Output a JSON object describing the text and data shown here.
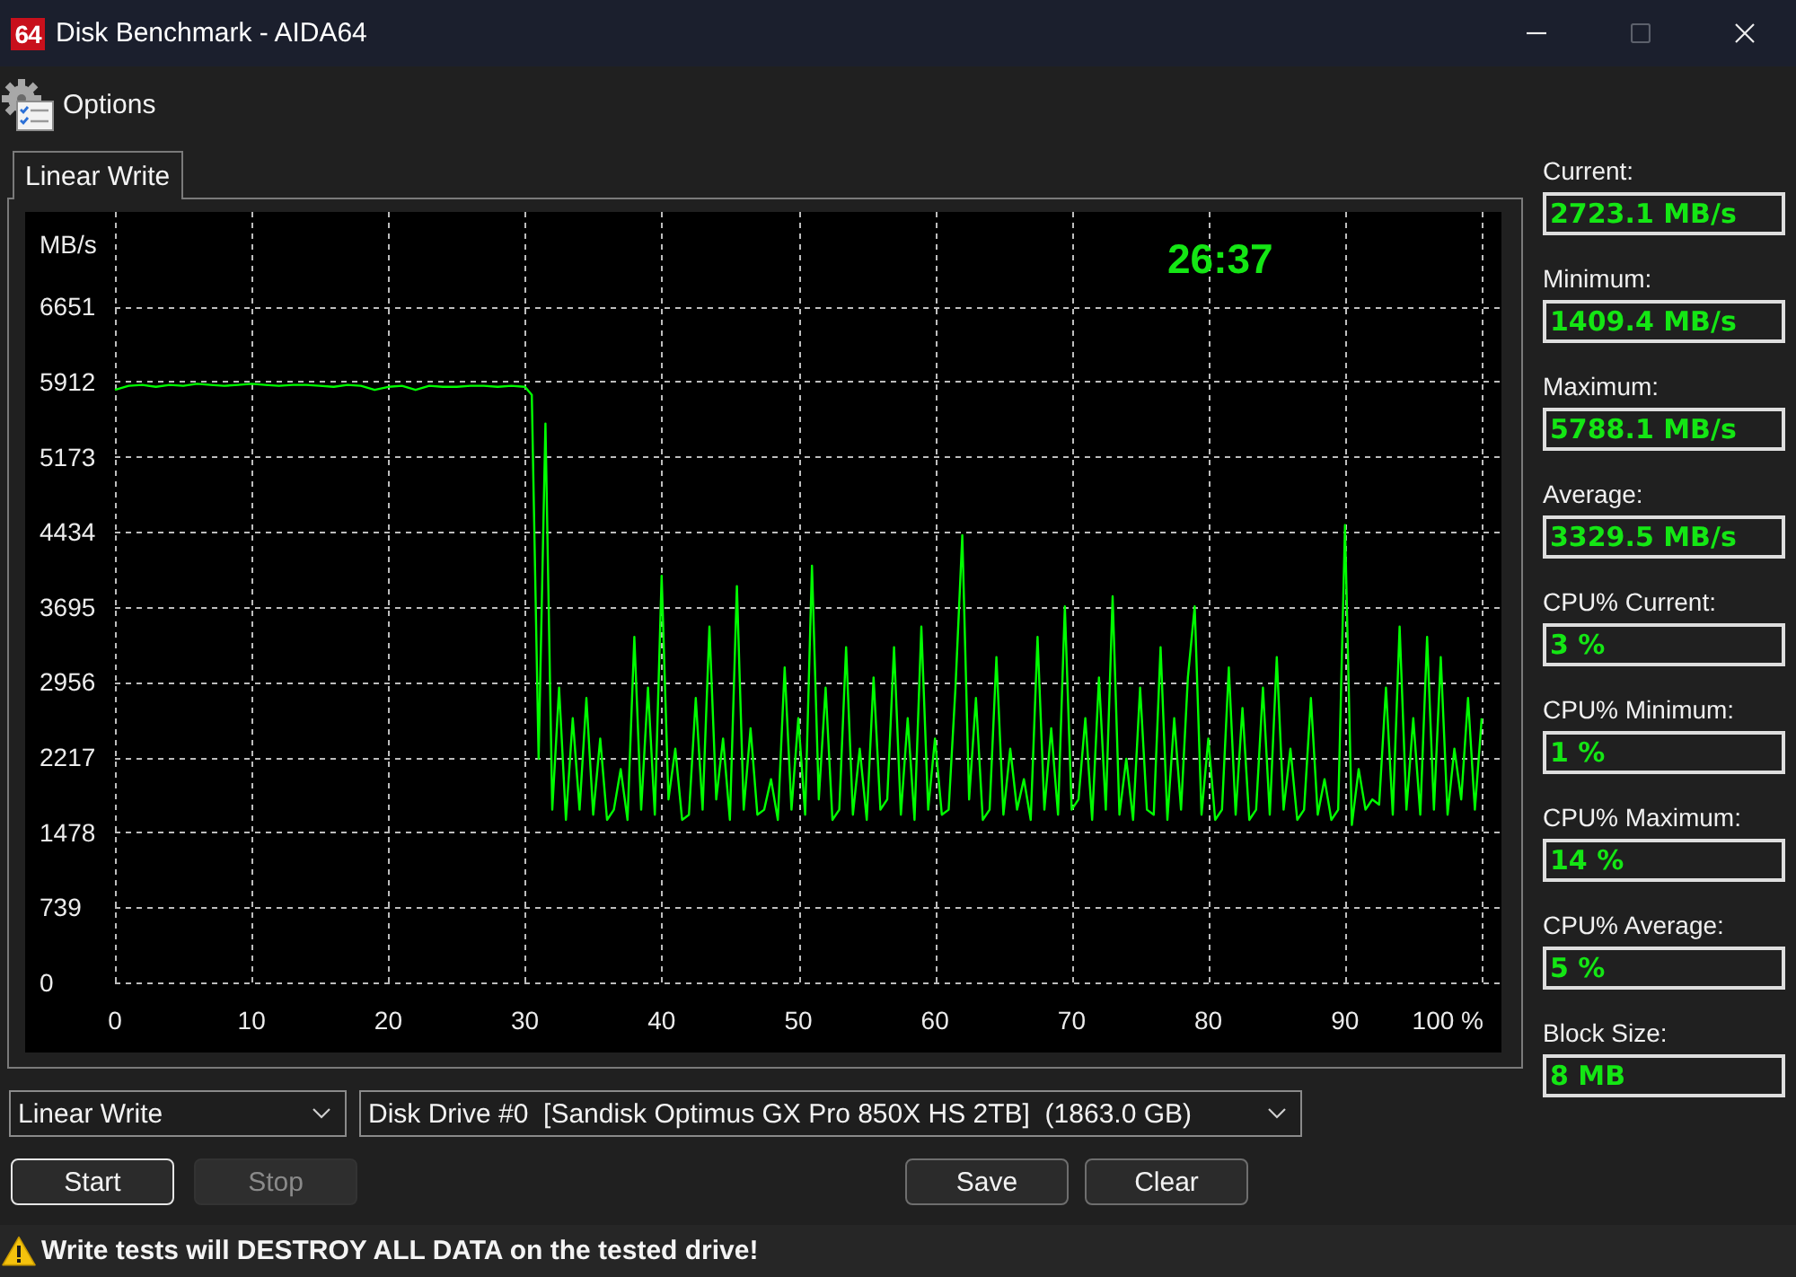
{
  "window": {
    "icon_label": "64",
    "title": "Disk Benchmark - AIDA64",
    "controls": [
      {
        "kind": "minimize",
        "disabled": false
      },
      {
        "kind": "maximize",
        "disabled": true
      },
      {
        "kind": "close",
        "disabled": false
      }
    ]
  },
  "toolbar": {
    "items": [
      {
        "label": "Options"
      }
    ]
  },
  "tabs": [
    {
      "label": "Linear Write",
      "selected": true
    }
  ],
  "benchmark_chart": {
    "elapsed_time": "26:37",
    "chart_data": {
      "type": "line",
      "grid": true,
      "ylabel": "MB/s",
      "xlim": [
        0,
        100
      ],
      "ylim": [
        0,
        7581
      ],
      "xticks": [
        0,
        10,
        20,
        30,
        40,
        50,
        60,
        70,
        80,
        90,
        {
          "value": 100,
          "label": "100 %"
        }
      ],
      "yticks": [
        0,
        739,
        1478,
        2217,
        2956,
        3695,
        4434,
        5173,
        5912,
        6651
      ],
      "x": [
        0,
        1,
        2,
        3,
        4,
        5,
        6,
        7,
        8,
        9,
        10,
        11,
        12,
        13,
        14,
        15,
        16,
        17,
        18,
        19,
        20,
        21,
        22,
        23,
        24,
        25,
        26,
        27,
        28,
        29,
        30,
        30.5,
        31,
        31.5,
        32,
        32.5,
        33,
        33.5,
        34,
        34.5,
        35,
        35.5,
        36,
        36.5,
        37,
        37.5,
        38,
        38.5,
        39,
        39.5,
        40,
        40.5,
        41,
        41.5,
        42,
        42.5,
        43,
        43.5,
        44,
        44.5,
        45,
        45.5,
        46,
        46.5,
        47,
        47.5,
        48,
        48.5,
        49,
        49.5,
        50,
        50.5,
        51,
        51.5,
        52,
        52.5,
        53,
        53.5,
        54,
        54.5,
        55,
        55.5,
        56,
        56.5,
        57,
        57.5,
        58,
        58.5,
        59,
        59.5,
        60,
        60.5,
        61,
        61.5,
        62,
        62.5,
        63,
        63.5,
        64,
        64.5,
        65,
        65.5,
        66,
        66.5,
        67,
        67.5,
        68,
        68.5,
        69,
        69.5,
        70,
        70.5,
        71,
        71.5,
        72,
        72.5,
        73,
        73.5,
        74,
        74.5,
        75,
        75.5,
        76,
        76.5,
        77,
        77.5,
        78,
        78.5,
        79,
        79.5,
        80,
        80.5,
        81,
        81.5,
        82,
        82.5,
        83,
        83.5,
        84,
        84.5,
        85,
        85.5,
        86,
        86.5,
        87,
        87.5,
        88,
        88.5,
        89,
        89.5,
        90,
        90.5,
        91,
        91.5,
        92,
        92.5,
        93,
        93.5,
        94,
        94.5,
        95,
        95.5,
        96,
        96.5,
        97,
        97.5,
        98,
        98.5,
        99,
        99.5,
        100
      ],
      "series": [
        {
          "color": "#00ff00",
          "values": [
            5830,
            5870,
            5880,
            5860,
            5880,
            5870,
            5890,
            5880,
            5870,
            5880,
            5890,
            5880,
            5870,
            5880,
            5880,
            5870,
            5860,
            5880,
            5870,
            5830,
            5860,
            5870,
            5830,
            5870,
            5860,
            5860,
            5870,
            5870,
            5860,
            5870,
            5860,
            5780,
            2200,
            5500,
            1700,
            2900,
            1600,
            2600,
            1700,
            2800,
            1650,
            2400,
            1600,
            1700,
            2100,
            1600,
            3400,
            1700,
            2900,
            1650,
            4000,
            1800,
            2300,
            1600,
            1650,
            2800,
            1700,
            3500,
            1800,
            2400,
            1600,
            3900,
            1700,
            2500,
            1650,
            1700,
            2000,
            1600,
            3100,
            1700,
            2600,
            1650,
            4100,
            1800,
            2900,
            1600,
            1700,
            3300,
            1650,
            2300,
            1600,
            3000,
            1700,
            1800,
            3300,
            1650,
            2600,
            1600,
            3500,
            1700,
            2400,
            1650,
            1700,
            2900,
            4400,
            1800,
            2800,
            1600,
            1700,
            3200,
            1650,
            2300,
            1700,
            2000,
            1600,
            3400,
            1700,
            2500,
            1650,
            3700,
            1700,
            1800,
            2600,
            1600,
            3000,
            1700,
            3800,
            1650,
            2200,
            1600,
            2900,
            1700,
            1650,
            3300,
            1600,
            2600,
            1700,
            3000,
            3700,
            1650,
            2400,
            1600,
            1700,
            3100,
            1650,
            2700,
            1600,
            1700,
            2900,
            1650,
            3200,
            1700,
            2300,
            1600,
            1700,
            2800,
            1650,
            2000,
            1600,
            1700,
            4500,
            1550,
            2100,
            1700,
            1800,
            1750,
            2900,
            1650,
            3500,
            1700,
            2600,
            1650,
            3400,
            1700,
            3200,
            1650,
            2300,
            1800,
            2800,
            1700,
            2600
          ]
        }
      ]
    }
  },
  "readout_groups": [
    {
      "items": [
        {
          "label": "Current:",
          "value": "2723.1 MB/s"
        },
        {
          "label": "Minimum:",
          "value": "1409.4 MB/s"
        },
        {
          "label": "Maximum:",
          "value": "5788.1 MB/s"
        },
        {
          "label": "Average:",
          "value": "3329.5 MB/s"
        }
      ]
    },
    {
      "items": [
        {
          "label": "CPU% Current:",
          "value": "3 %"
        },
        {
          "label": "CPU% Minimum:",
          "value": "1 %"
        },
        {
          "label": "CPU% Maximum:",
          "value": "14 %"
        },
        {
          "label": "CPU% Average:",
          "value": "5 %"
        },
        {
          "label": "Block Size:",
          "value": "8 MB"
        }
      ]
    }
  ],
  "test_select": {
    "value": "Linear Write"
  },
  "drive_select": {
    "value": "Disk Drive #0  [Sandisk Optimus GX Pro 850X HS 2TB]  (1863.0 GB)"
  },
  "run_buttons": [
    {
      "label": "Start",
      "disabled": false,
      "focused": true
    },
    {
      "label": "Stop",
      "disabled": true,
      "focused": false
    }
  ],
  "result_buttons": [
    {
      "label": "Save",
      "disabled": false,
      "focused": false
    },
    {
      "label": "Clear",
      "disabled": false,
      "focused": false
    }
  ],
  "status_bar": {
    "message": "Write tests will DESTROY ALL DATA on the tested drive!"
  }
}
